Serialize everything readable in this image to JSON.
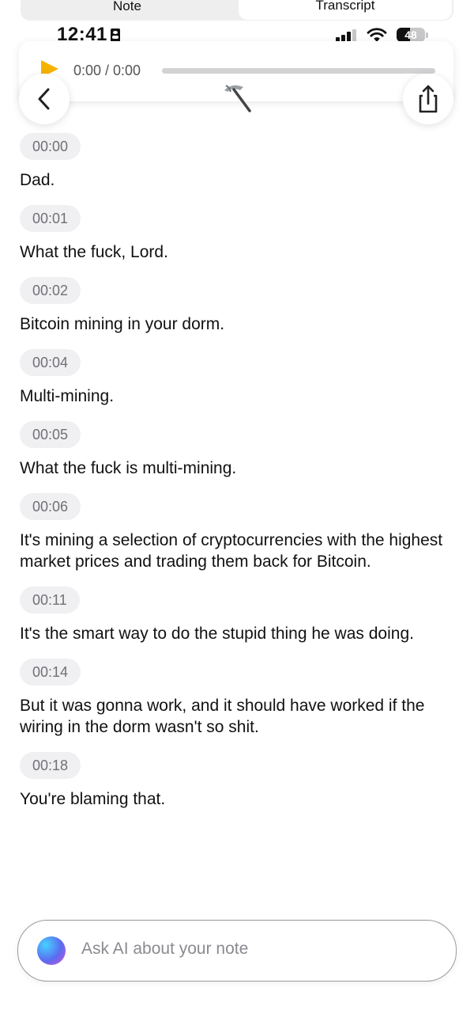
{
  "tabs": {
    "note": "Note",
    "transcript": "Transcript",
    "active": "transcript"
  },
  "status_bar": {
    "time": "12:41",
    "battery": "48",
    "battery_level": 0.48
  },
  "player": {
    "time": "0:00 / 0:00",
    "progress": 0.0,
    "accent": "#f5b301"
  },
  "icons": {
    "back": "chevron-left-icon",
    "share": "share-icon",
    "pickaxe": "pickaxe-icon",
    "play": "play-icon",
    "ai": "ai-orb-icon"
  },
  "transcript": [
    {
      "time": "00:00",
      "text": "Dad."
    },
    {
      "time": "00:01",
      "text": "What the fuck, Lord."
    },
    {
      "time": "00:02",
      "text": "Bitcoin mining in your dorm."
    },
    {
      "time": "00:04",
      "text": "Multi-mining."
    },
    {
      "time": "00:05",
      "text": "What the fuck is multi-mining."
    },
    {
      "time": "00:06",
      "text": "It's mining a selection of cryptocurrencies with the highest market prices and trading them back for Bitcoin."
    },
    {
      "time": "00:11",
      "text": "It's the smart way to do the stupid thing he was doing."
    },
    {
      "time": "00:14",
      "text": "But it was gonna work, and it should have worked if the wiring in the dorm wasn't so shit."
    },
    {
      "time": "00:18",
      "text": "You're blaming that."
    }
  ],
  "ask_ai": {
    "placeholder": "Ask AI about your note"
  }
}
